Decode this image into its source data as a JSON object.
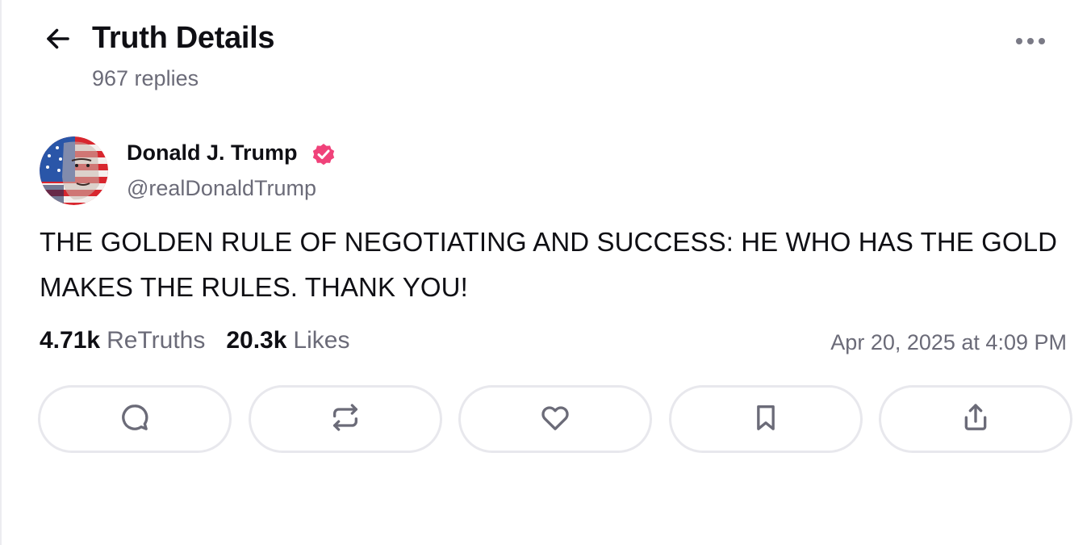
{
  "header": {
    "title": "Truth Details",
    "reply_count": "967 replies"
  },
  "post": {
    "author": {
      "name": "Donald J. Trump",
      "handle": "@realDonaldTrump",
      "verified": true,
      "badge_color": "#f0427a"
    },
    "body": "THE GOLDEN RULE OF NEGOTIATING AND SUCCESS: HE WHO HAS THE GOLD MAKES THE RULES. THANK YOU!",
    "stats": {
      "retruths_count": "4.71k",
      "retruths_label": "ReTruths",
      "likes_count": "20.3k",
      "likes_label": "Likes"
    },
    "timestamp": "Apr 20, 2025 at 4:09 PM"
  },
  "actions": [
    {
      "name": "reply",
      "icon": "comment-icon"
    },
    {
      "name": "retruth",
      "icon": "repost-icon"
    },
    {
      "name": "like",
      "icon": "heart-icon"
    },
    {
      "name": "bookmark",
      "icon": "bookmark-icon"
    },
    {
      "name": "share",
      "icon": "share-icon"
    }
  ],
  "colors": {
    "text": "#0f0f14",
    "muted": "#6b6b78",
    "icon": "#6b6b78",
    "border": "#e8e8ed"
  }
}
